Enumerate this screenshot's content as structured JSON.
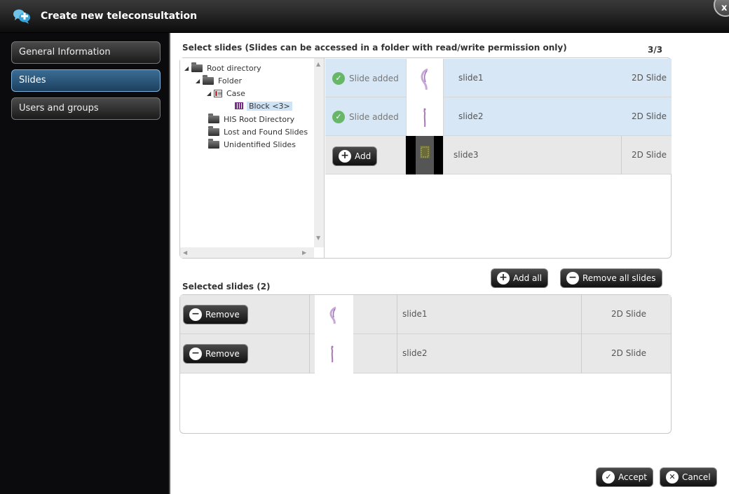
{
  "window": {
    "title": "Create new teleconsultation",
    "close_label": "x"
  },
  "nav": {
    "items": [
      {
        "label": "General Information",
        "active": false
      },
      {
        "label": "Slides",
        "active": true
      },
      {
        "label": "Users and groups",
        "active": false
      }
    ]
  },
  "select_slides": {
    "heading": "Select slides (Slides can be accessed in a folder with read/write permission only)",
    "count": "3/3",
    "tree": [
      {
        "label": "Root directory",
        "level": 0,
        "expander": "◢",
        "icon": "folder-icon"
      },
      {
        "label": "Folder",
        "level": 1,
        "expander": "◢",
        "icon": "folder-icon"
      },
      {
        "label": "Case",
        "level": 2,
        "expander": "◢",
        "icon": "case-icon"
      },
      {
        "label": "Block <3>",
        "level": 3,
        "expander": "",
        "icon": "block-icon",
        "selected": true
      },
      {
        "label": "HIS Root Directory",
        "level": 1,
        "expander": "",
        "icon": "folder-icon"
      },
      {
        "label": "Lost and Found Slides",
        "level": 1,
        "expander": "",
        "icon": "folder-icon"
      },
      {
        "label": "Unidentified Slides",
        "level": 1,
        "expander": "",
        "icon": "folder-icon"
      }
    ],
    "slides": [
      {
        "status": "Slide added",
        "name": "slide1",
        "type": "2D Slide",
        "added": true
      },
      {
        "status": "Slide added",
        "name": "slide2",
        "type": "2D Slide",
        "added": true
      },
      {
        "status": "",
        "add_label": "Add",
        "name": "slide3",
        "type": "2D Slide",
        "added": false
      }
    ]
  },
  "actions": {
    "add_all_label": "Add all",
    "remove_all_label": "Remove all slides"
  },
  "selected_slides": {
    "heading": "Selected slides (2)",
    "rows": [
      {
        "remove_label": "Remove",
        "name": "slide1",
        "type": "2D Slide"
      },
      {
        "remove_label": "Remove",
        "name": "slide2",
        "type": "2D Slide"
      }
    ]
  },
  "footer": {
    "accept_label": "Accept",
    "cancel_label": "Cancel"
  },
  "colors": {
    "active_nav": "#2d5a80",
    "added_row": "#d7e7f6",
    "check_green": "#68b768"
  }
}
